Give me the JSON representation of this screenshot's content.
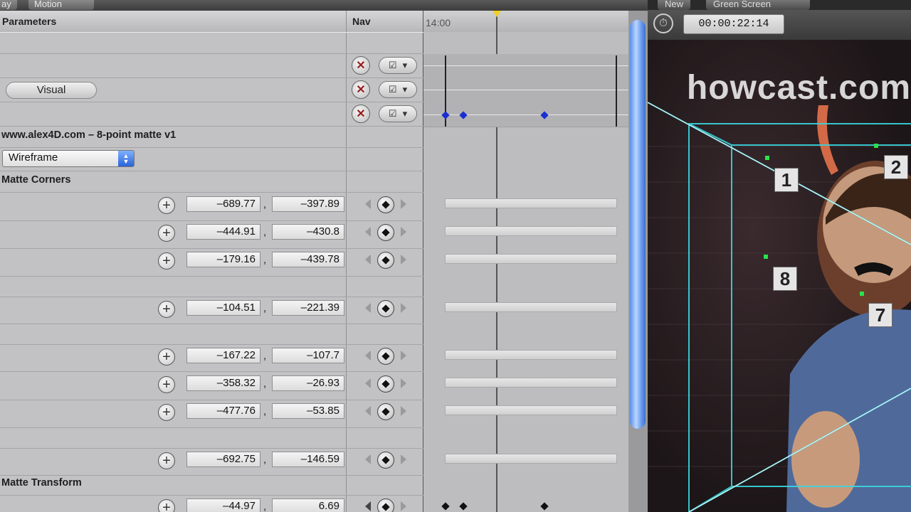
{
  "top_tabs": [
    "ay",
    "Motion"
  ],
  "viewer_tabs": [
    "New",
    "Green Screen"
  ],
  "params": {
    "header": "Parameters",
    "nav_header": "Nav",
    "visual_button": "Visual",
    "plugin_title": "www.alex4D.com – 8-point matte v1",
    "mode_select": "Wireframe",
    "section_corners": "Matte Corners",
    "section_transform": "Matte Transform",
    "corners": [
      {
        "x": "–689.77",
        "y": "–397.89"
      },
      {
        "x": "–444.91",
        "y": "–430.8"
      },
      {
        "x": "–179.16",
        "y": "–439.78"
      },
      {
        "x": "–104.51",
        "y": "–221.39"
      },
      {
        "x": "–167.22",
        "y": "–107.7"
      },
      {
        "x": "–358.32",
        "y": "–26.93"
      },
      {
        "x": "–477.76",
        "y": "–53.85"
      },
      {
        "x": "–692.75",
        "y": "–146.59"
      }
    ],
    "transform": {
      "x": "–44.97",
      "y": "6.69"
    },
    "comma": ","
  },
  "timeline": {
    "time_label": "14:00",
    "keyframe_color": "#1a2fd0"
  },
  "viewer": {
    "timecode": "00:00:22:14",
    "watermark": "howcast.com",
    "markers": [
      "1",
      "2",
      "8",
      "7"
    ]
  },
  "colors": {
    "wire": "#39d7e0",
    "scroll_thumb": "#6fa0f0"
  }
}
